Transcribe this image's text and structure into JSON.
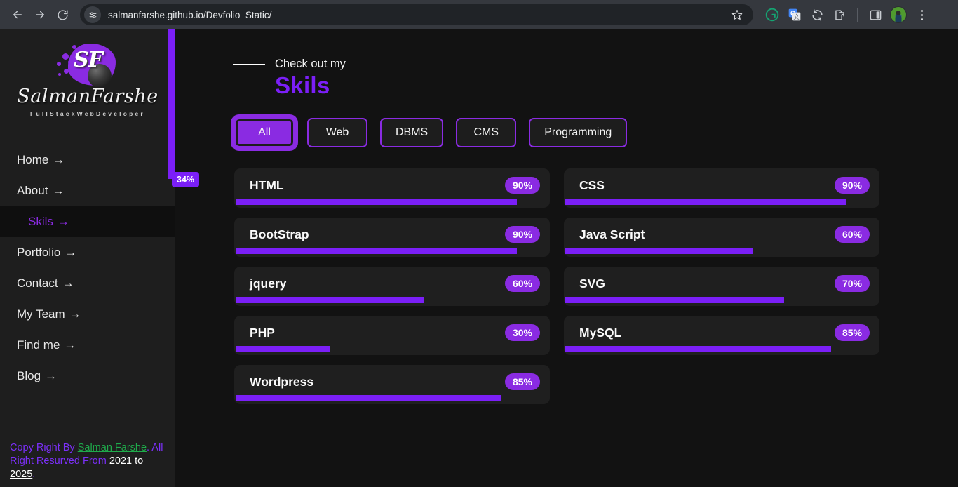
{
  "browser": {
    "back_label": "back",
    "forward_label": "forward",
    "reload_label": "reload",
    "url": "salmanfarshe.github.io/Devfolio_Static/",
    "bookmark_label": "bookmark",
    "extensions": [
      "grammarly-icon",
      "google-translate-icon",
      "sync-icon",
      "extensions-puzzle-icon"
    ],
    "side_panel_label": "side panel",
    "profile_label": "profile",
    "menu_label": "chrome menu"
  },
  "sidebar": {
    "logo": {
      "monogram": "SF",
      "name": "SalmanFarshe",
      "tagline": "FullStackWebDeveloper"
    },
    "nav": [
      {
        "label": "Home",
        "arrow": "→",
        "active": false
      },
      {
        "label": "About",
        "arrow": "→",
        "active": false
      },
      {
        "label": "Skils",
        "arrow": "→",
        "active": true
      },
      {
        "label": "Portfolio",
        "arrow": "→",
        "active": false
      },
      {
        "label": "Contact",
        "arrow": "→",
        "active": false
      },
      {
        "label": "My Team",
        "arrow": "→",
        "active": false
      },
      {
        "label": "Find me",
        "arrow": "→",
        "active": false
      },
      {
        "label": "Blog",
        "arrow": "→",
        "active": false
      }
    ],
    "footer": {
      "prefix": "Copy Right By ",
      "author": "Salman Farshe",
      "middle": ". All Right Resurved From ",
      "years": "2021 to 2025",
      "suffix": "."
    }
  },
  "scroll_progress": {
    "percent_label": "34%",
    "percent": 34
  },
  "main": {
    "eyebrow": "Check out my",
    "heading": "Skils",
    "filters": [
      {
        "label": "All",
        "active": true
      },
      {
        "label": "Web",
        "active": false
      },
      {
        "label": "DBMS",
        "active": false
      },
      {
        "label": "CMS",
        "active": false
      },
      {
        "label": "Programming",
        "active": false
      }
    ],
    "skills": [
      {
        "name": "HTML",
        "percent": 90,
        "percent_label": "90%"
      },
      {
        "name": "CSS",
        "percent": 90,
        "percent_label": "90%"
      },
      {
        "name": "BootStrap",
        "percent": 90,
        "percent_label": "90%"
      },
      {
        "name": "Java Script",
        "percent": 60,
        "percent_label": "60%"
      },
      {
        "name": "jquery",
        "percent": 60,
        "percent_label": "60%"
      },
      {
        "name": "SVG",
        "percent": 70,
        "percent_label": "70%"
      },
      {
        "name": "PHP",
        "percent": 30,
        "percent_label": "30%"
      },
      {
        "name": "MySQL",
        "percent": 85,
        "percent_label": "85%"
      },
      {
        "name": "Wordpress",
        "percent": 85,
        "percent_label": "85%"
      }
    ]
  },
  "colors": {
    "accent": "#8a2be2",
    "accent_bright": "#7b1ff7",
    "page_bg": "#121212",
    "sidebar_bg": "#1e1e1e",
    "card_bg": "#1f1f1f",
    "link_green": "#1faa4b",
    "chrome_bg": "#35383e"
  }
}
